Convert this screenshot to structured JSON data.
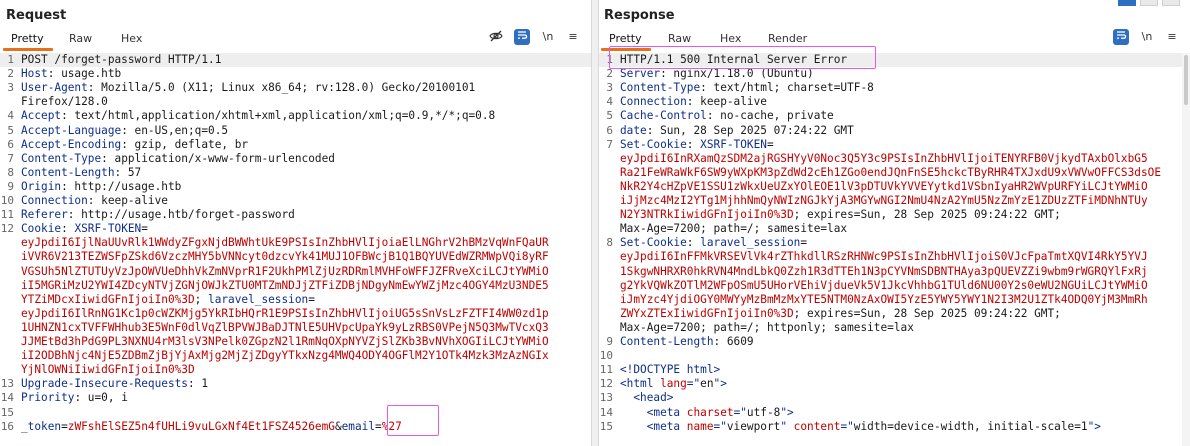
{
  "request": {
    "title": "Request",
    "tabs": [
      "Pretty",
      "Raw",
      "Hex"
    ],
    "active_tab": "Pretty",
    "tools": {
      "eye_off": "eye-off-icon",
      "wrap": "wrap-icon",
      "newline": "\\n",
      "menu": "≡"
    },
    "lines": [
      {
        "n": "1",
        "parts": [
          {
            "t": "POST /forget-password HTTP/1.1",
            "c": ""
          }
        ]
      },
      {
        "n": "2",
        "parts": [
          {
            "t": "Host",
            "c": "key"
          },
          {
            "t": ": usage.htb",
            "c": ""
          }
        ]
      },
      {
        "n": "3",
        "parts": [
          {
            "t": "User-Agent",
            "c": "key"
          },
          {
            "t": ": Mozilla/5.0 (X11; Linux x86_64; rv:128.0) Gecko/20100101",
            "c": ""
          }
        ]
      },
      {
        "n": "",
        "parts": [
          {
            "t": "Firefox/128.0",
            "c": ""
          }
        ]
      },
      {
        "n": "4",
        "parts": [
          {
            "t": "Accept",
            "c": "key"
          },
          {
            "t": ": text/html,application/xhtml+xml,application/xml;q=0.9,*/*;q=0.8",
            "c": ""
          }
        ]
      },
      {
        "n": "5",
        "parts": [
          {
            "t": "Accept-Language",
            "c": "key"
          },
          {
            "t": ": en-US,en;q=0.5",
            "c": ""
          }
        ]
      },
      {
        "n": "6",
        "parts": [
          {
            "t": "Accept-Encoding",
            "c": "key"
          },
          {
            "t": ": gzip, deflate, br",
            "c": ""
          }
        ]
      },
      {
        "n": "7",
        "parts": [
          {
            "t": "Content-Type",
            "c": "key"
          },
          {
            "t": ": application/x-www-form-urlencoded",
            "c": ""
          }
        ]
      },
      {
        "n": "8",
        "parts": [
          {
            "t": "Content-Length",
            "c": "key"
          },
          {
            "t": ": 57",
            "c": ""
          }
        ]
      },
      {
        "n": "9",
        "parts": [
          {
            "t": "Origin",
            "c": "key"
          },
          {
            "t": ": http://usage.htb",
            "c": ""
          }
        ]
      },
      {
        "n": "10",
        "parts": [
          {
            "t": "Connection",
            "c": "key"
          },
          {
            "t": ": keep-alive",
            "c": ""
          }
        ]
      },
      {
        "n": "11",
        "parts": [
          {
            "t": "Referer",
            "c": "key"
          },
          {
            "t": ": http://usage.htb/forget-password",
            "c": ""
          }
        ]
      },
      {
        "n": "12",
        "parts": [
          {
            "t": "Cookie",
            "c": "key"
          },
          {
            "t": ": ",
            "c": ""
          },
          {
            "t": "XSRF-TOKEN",
            "c": "key"
          },
          {
            "t": "=",
            "c": ""
          }
        ]
      },
      {
        "n": "",
        "parts": [
          {
            "t": "eyJpdiI6IjlNaUUvRlk1WWdyZFgxNjdBWWhtUkE9PSIsInZhbHVlIjoiaElLNGhrV2hBMzVqWnFQaUR",
            "c": "cookie"
          }
        ]
      },
      {
        "n": "",
        "parts": [
          {
            "t": "iVVR6V213TEZWSFpZSkd6VzczMHY5bVNNcyt0dzcvYk41MUJ1OFBWcjB1Q1BQYUVEdWZRMWpVQi8yRF",
            "c": "cookie"
          }
        ]
      },
      {
        "n": "",
        "parts": [
          {
            "t": "VGSUh5NlZTUTUyVzJpOWVUeDhhVkZmNVprR1F2UkhPMlZjUzRDRmlMVHFoWFFJZFRveXciLCJtYWMiO",
            "c": "cookie"
          }
        ]
      },
      {
        "n": "",
        "parts": [
          {
            "t": "iI5MGRiMzU2YWI4ZDcyNTVjZGNjOWJkZTU0MTZmNDJjZTFiZDBjNDgyNmEwYWZjMzc4OGY4MzU3NDE5",
            "c": "cookie"
          }
        ]
      },
      {
        "n": "",
        "parts": [
          {
            "t": "YTZiMDcxIiwidGFnIjoiIn0%3D",
            "c": "cookie"
          },
          {
            "t": "; ",
            "c": ""
          },
          {
            "t": "laravel_session",
            "c": "key"
          },
          {
            "t": "=",
            "c": ""
          }
        ]
      },
      {
        "n": "",
        "parts": [
          {
            "t": "eyJpdiI6IlRnNG1Kc1p0cWZKMjg5YkRIbHQrR1E9PSIsInZhbHVlIjoiUG5sSnVsLzFZTFI4WW0zd1p",
            "c": "cookie"
          }
        ]
      },
      {
        "n": "",
        "parts": [
          {
            "t": "1UHNZN1cxTVFFWHhub3E5WnF0dlVqZlBPVWJBaDJTNlE5UHVpcUpaYk9yLzRBS0VPejN5Q3MwTVcxQ3",
            "c": "cookie"
          }
        ]
      },
      {
        "n": "",
        "parts": [
          {
            "t": "JJMEtBd3hPdG9PL3NXNU4rM3lsV3NPelk0ZGpzN2l1RmNqOXpNYVZjSlZKb3BvNVhXOGIiLCJtYWMiO",
            "c": "cookie"
          }
        ]
      },
      {
        "n": "",
        "parts": [
          {
            "t": "iI2ODBhNjc4NjE5ZDBmZjBjYjAxMjg2MjZjZDgyYTkxNzg4MWQ4ODY4OGFlM2Y1OTk4Mzk3MzAzNGIx",
            "c": "cookie"
          }
        ]
      },
      {
        "n": "",
        "parts": [
          {
            "t": "YjNlOWNiIiwidGFnIjoiIn0%3D",
            "c": "cookie"
          }
        ]
      },
      {
        "n": "13",
        "parts": [
          {
            "t": "Upgrade-Insecure-Requests",
            "c": "key"
          },
          {
            "t": ": 1",
            "c": ""
          }
        ]
      },
      {
        "n": "14",
        "parts": [
          {
            "t": "Priority",
            "c": "key"
          },
          {
            "t": ": u=0, i",
            "c": ""
          }
        ]
      },
      {
        "n": "15",
        "parts": [
          {
            "t": "",
            "c": ""
          }
        ]
      },
      {
        "n": "16",
        "parts": [
          {
            "t": "_token",
            "c": "key"
          },
          {
            "t": "=",
            "c": ""
          },
          {
            "t": "zWFshElSEZ5n4fUHLi9vuLGxNf4Et1FSZ4526emG",
            "c": "cookie"
          },
          {
            "t": "&",
            "c": ""
          },
          {
            "t": "email",
            "c": "key"
          },
          {
            "t": "=",
            "c": ""
          },
          {
            "t": "%27",
            "c": "cookie"
          }
        ]
      }
    ]
  },
  "response": {
    "title": "Response",
    "tabs": [
      "Pretty",
      "Raw",
      "Hex",
      "Render"
    ],
    "active_tab": "Pretty",
    "tools": {
      "wrap": "wrap-icon",
      "newline": "\\n",
      "menu": "≡"
    },
    "lines": [
      {
        "n": "1",
        "parts": [
          {
            "t": "HTTP/1.1 500 Internal Server Error",
            "c": ""
          }
        ]
      },
      {
        "n": "2",
        "parts": [
          {
            "t": "Server",
            "c": "key"
          },
          {
            "t": ": nginx/1.18.0 (Ubuntu)",
            "c": ""
          }
        ]
      },
      {
        "n": "3",
        "parts": [
          {
            "t": "Content-Type",
            "c": "key"
          },
          {
            "t": ": text/html; charset=UTF-8",
            "c": ""
          }
        ]
      },
      {
        "n": "4",
        "parts": [
          {
            "t": "Connection",
            "c": "key"
          },
          {
            "t": ": keep-alive",
            "c": ""
          }
        ]
      },
      {
        "n": "5",
        "parts": [
          {
            "t": "Cache-Control",
            "c": "key"
          },
          {
            "t": ": no-cache, private",
            "c": ""
          }
        ]
      },
      {
        "n": "6",
        "parts": [
          {
            "t": "date",
            "c": "key"
          },
          {
            "t": ": Sun, 28 Sep 2025 07:24:22 GMT",
            "c": ""
          }
        ]
      },
      {
        "n": "7",
        "parts": [
          {
            "t": "Set-Cookie",
            "c": "key"
          },
          {
            "t": ": ",
            "c": ""
          },
          {
            "t": "XSRF-TOKEN",
            "c": "key"
          },
          {
            "t": "=",
            "c": ""
          }
        ]
      },
      {
        "n": "",
        "parts": [
          {
            "t": "eyJpdiI6InRXamQzSDM2ajRGSHYyV0Noc3Q5Y3c9PSIsInZhbHVlIjoiTENYRFB0VjkydTAxbOlxbG5",
            "c": "cookie"
          }
        ]
      },
      {
        "n": "",
        "parts": [
          {
            "t": "Ra21FeWRaWkF6SW9yWXpKM3pZdWd2cEh1ZGo0endJQnFnSE5hckcTByRHR4TXJxdU9xVWVwOFFCS3dsOE",
            "c": "cookie"
          }
        ]
      },
      {
        "n": "",
        "parts": [
          {
            "t": "NkR2Y4cHZpVE1SSU1zWkxUeUZxYOlEOE1lV3pDTUVkYVVEYytkd1VSbnIyaHR2WVpURFYiLCJtYWMiO",
            "c": "cookie"
          }
        ]
      },
      {
        "n": "",
        "parts": [
          {
            "t": "iJjMzc4MzI2YTg1MjhhNmQyNWIzNGJkYjA3MGYwNGI2NmU4NzA2YmU5NzZmYzE1ZDUzZTFiMDNhNTUy",
            "c": "cookie"
          }
        ]
      },
      {
        "n": "",
        "parts": [
          {
            "t": "N2Y3NTRkIiwidGFnIjoiIn0%3D",
            "c": "cookie"
          },
          {
            "t": "; expires=Sun, 28 Sep 2025 09:24:22 GMT;",
            "c": ""
          }
        ]
      },
      {
        "n": "",
        "parts": [
          {
            "t": "Max-Age=7200; path=/; samesite=lax",
            "c": ""
          }
        ]
      },
      {
        "n": "8",
        "parts": [
          {
            "t": "Set-Cookie",
            "c": "key"
          },
          {
            "t": ": ",
            "c": ""
          },
          {
            "t": "laravel_session",
            "c": "key"
          },
          {
            "t": "=",
            "c": ""
          }
        ]
      },
      {
        "n": "",
        "parts": [
          {
            "t": "eyJpdiI6InFFMkVRSEVlVk4rZThkdllRSzRHNWc9PSIsInZhbHVlIjoiS0VJcFpaTmtXQVI4RkY5YVJ",
            "c": "cookie"
          }
        ]
      },
      {
        "n": "",
        "parts": [
          {
            "t": "1SkgwNHRXR0hkRVN4MndLbkQ0Zzh1R3dTTEh1N3pCYVNmSDBNTHAya3pQUEVZZi9wbm9rWGRQYlFxRj",
            "c": "cookie"
          }
        ]
      },
      {
        "n": "",
        "parts": [
          {
            "t": "g2YkVQWkZOTlM2WFpOSmU5UHorVEhiVjdueVk5V1JkcVhhbG1TUld6NU00Y2s0eWU2NGUiLCJtYWMiO",
            "c": "cookie"
          }
        ]
      },
      {
        "n": "",
        "parts": [
          {
            "t": "iJmYzc4YjdiOGY0MWYyMzBmMzMxYTE5NTM0NzAxOWI5YzE5YWY5YWY1N2I3M2U1ZTk4ODQ0YjM3MmRh",
            "c": "cookie"
          }
        ]
      },
      {
        "n": "",
        "parts": [
          {
            "t": "ZWYxZTExIiwidGFnIjoiIn0%3D",
            "c": "cookie"
          },
          {
            "t": "; expires=Sun, 28 Sep 2025 09:24:22 GMT;",
            "c": ""
          }
        ]
      },
      {
        "n": "",
        "parts": [
          {
            "t": "Max-Age=7200; path=/; httponly; samesite=lax",
            "c": ""
          }
        ]
      },
      {
        "n": "9",
        "parts": [
          {
            "t": "Content-Length",
            "c": "key"
          },
          {
            "t": ": 6609",
            "c": ""
          }
        ]
      },
      {
        "n": "10",
        "parts": [
          {
            "t": "",
            "c": ""
          }
        ]
      },
      {
        "n": "11",
        "parts": [
          {
            "t": "<!DOCTYPE html>",
            "c": "tag"
          }
        ]
      },
      {
        "n": "12",
        "parts": [
          {
            "t": "<html ",
            "c": "tag"
          },
          {
            "t": "lang",
            "c": "attrname"
          },
          {
            "t": "=\"",
            "c": "tag"
          },
          {
            "t": "en",
            "c": ""
          },
          {
            "t": "\">",
            "c": "tag"
          }
        ]
      },
      {
        "n": "13",
        "parts": [
          {
            "t": "  <head>",
            "c": "tag"
          }
        ]
      },
      {
        "n": "14",
        "parts": [
          {
            "t": "    <meta ",
            "c": "tag"
          },
          {
            "t": "charset",
            "c": "attrname"
          },
          {
            "t": "=\"",
            "c": "tag"
          },
          {
            "t": "utf-8",
            "c": ""
          },
          {
            "t": "\">",
            "c": "tag"
          }
        ]
      },
      {
        "n": "15",
        "parts": [
          {
            "t": "    <meta ",
            "c": "tag"
          },
          {
            "t": "name",
            "c": "attrname"
          },
          {
            "t": "=\"",
            "c": "tag"
          },
          {
            "t": "viewport",
            "c": ""
          },
          {
            "t": "\" ",
            "c": "tag"
          },
          {
            "t": "content",
            "c": "attrname"
          },
          {
            "t": "=\"",
            "c": "tag"
          },
          {
            "t": "width=device-width, initial-scale=1",
            "c": ""
          },
          {
            "t": "\">",
            "c": "tag"
          }
        ]
      }
    ]
  }
}
